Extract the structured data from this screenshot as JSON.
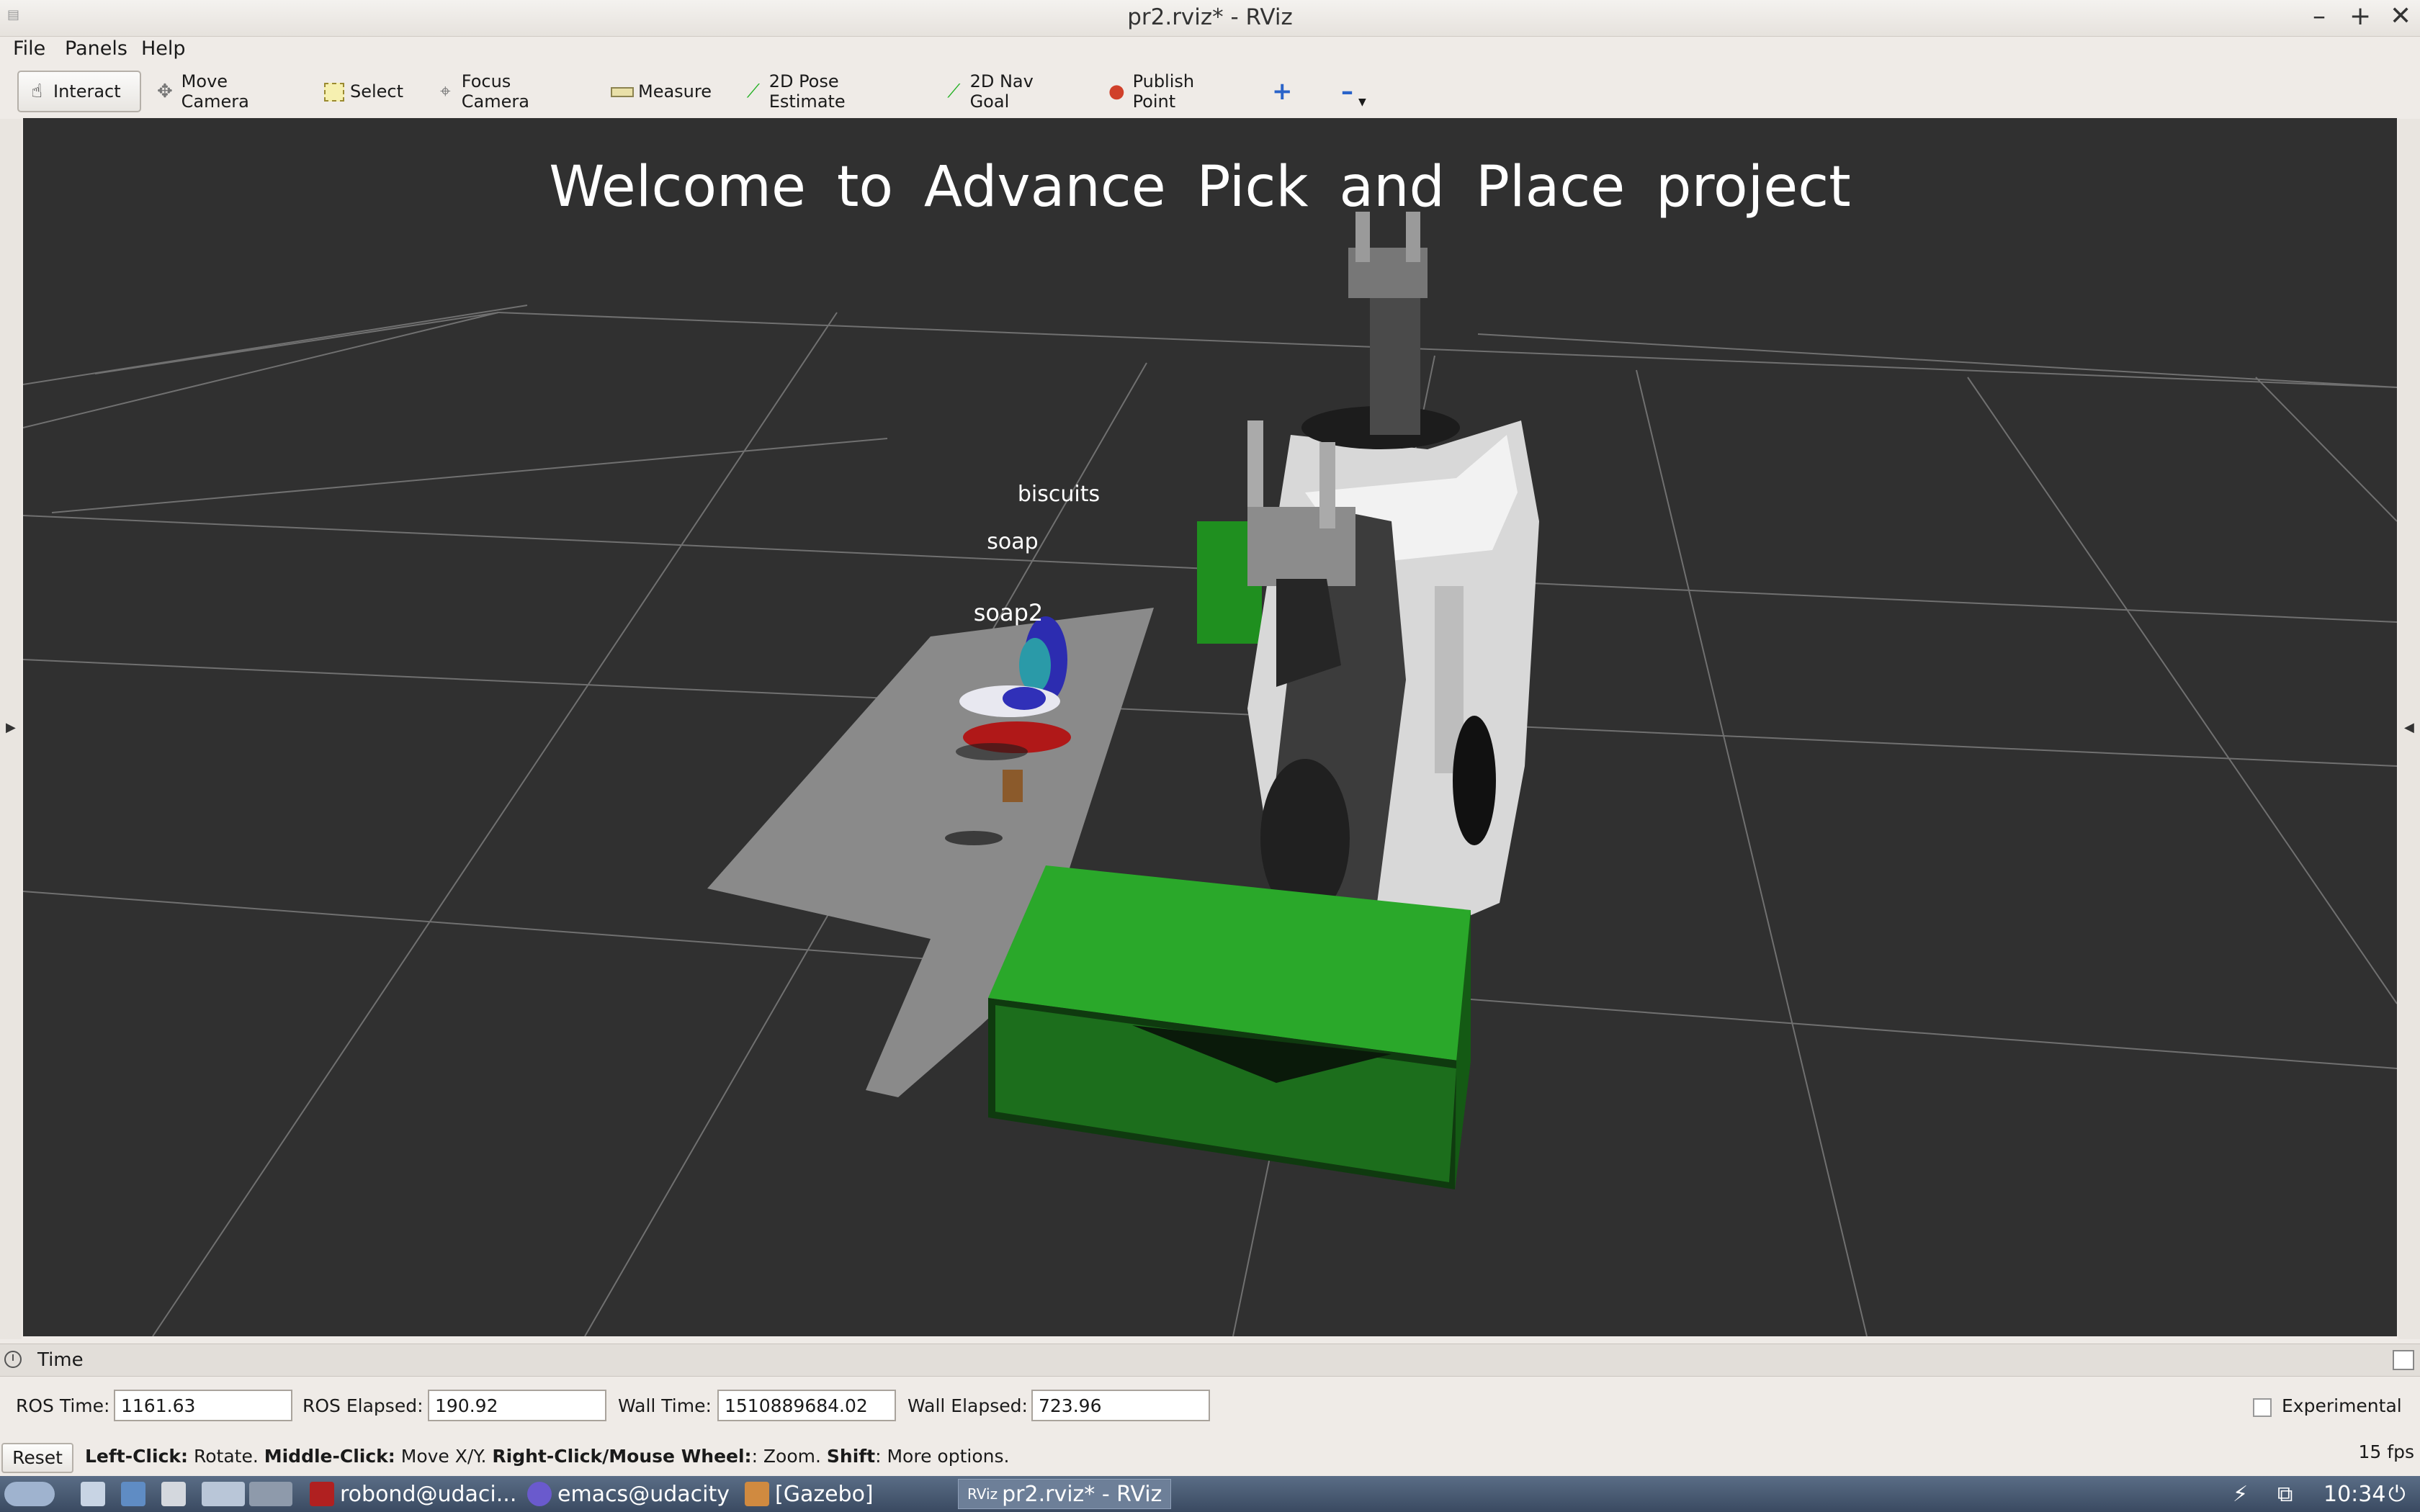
{
  "window": {
    "title": "pr2.rviz* - RViz",
    "app_icon": "rviz-icon",
    "minimize": "–",
    "maximize": "+",
    "close": "✕"
  },
  "menu": {
    "file": "File",
    "panels": "Panels",
    "help": "Help"
  },
  "toolbar": {
    "interact": "Interact",
    "move_camera": "Move Camera",
    "select": "Select",
    "focus_camera": "Focus Camera",
    "measure": "Measure",
    "pose_estimate": "2D Pose Estimate",
    "nav_goal": "2D Nav Goal",
    "publish_point": "Publish Point",
    "add_tool": "+",
    "remove_tool": "–"
  },
  "viewport": {
    "banner": "Welcome to Advance Pick and Place project",
    "labels": {
      "biscuits": "biscuits",
      "soap": "soap",
      "soap2": "soap2"
    },
    "colors": {
      "background": "#303030",
      "grid": "#a0a0a0",
      "bin": "#1f8f1f",
      "table": "#8a8a8a",
      "robot": "#d9d9d9"
    }
  },
  "time_panel": {
    "title": "Time",
    "ros_time_label": "ROS Time:",
    "ros_time": "1161.63",
    "ros_elapsed_label": "ROS Elapsed:",
    "ros_elapsed": "190.92",
    "wall_time_label": "Wall Time:",
    "wall_time": "1510889684.02",
    "wall_elapsed_label": "Wall Elapsed:",
    "wall_elapsed": "723.96",
    "experimental_label": "Experimental",
    "experimental_checked": false
  },
  "status": {
    "reset": "Reset",
    "left_click": "Left-Click:",
    "left_click_desc": " Rotate. ",
    "middle_click": "Middle-Click:",
    "middle_click_desc": " Move X/Y. ",
    "right_click": "Right-Click/Mouse Wheel:",
    "right_click_desc": ": Zoom. ",
    "shift": "Shift",
    "shift_desc": ": More options.",
    "fps": "15 fps"
  },
  "taskbar": {
    "terminal": "robond@udaci...",
    "emacs": "emacs@udacity",
    "gazebo": "[Gazebo]",
    "rviz": "pr2.rviz* - RViz",
    "clock": "10:34"
  }
}
